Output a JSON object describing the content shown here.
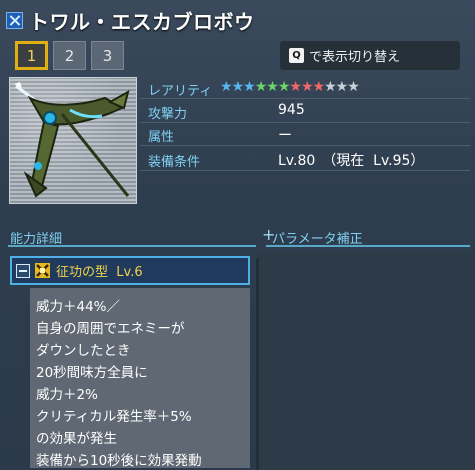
{
  "title": "トワル・エスカブロボウ",
  "tabs": [
    "1",
    "2",
    "3"
  ],
  "active_tab": 0,
  "toggle": {
    "key": "Q",
    "text": "で表示切り替え"
  },
  "stats": {
    "rarity_label": "レアリティ",
    "rarity_stars": [
      "#55b6f0",
      "#55b6f0",
      "#55b6f0",
      "#6cd46a",
      "#6cd46a",
      "#6cd46a",
      "#f06868",
      "#f06868",
      "#f06868",
      "#c8d0d8",
      "#c8d0d8",
      "#c8d0d8"
    ],
    "attack_label": "攻撃力",
    "attack_value": "945",
    "element_label": "属性",
    "element_value": "ー",
    "requirement_label": "装備条件",
    "requirement_value": "Lv.80　（現在  Lv.95）"
  },
  "sections": {
    "ability_header": "能力詳細",
    "param_header": "パラメータ補正"
  },
  "ability": {
    "name": "征功の型",
    "level": "Lv.6",
    "description": [
      "威力＋44%／",
      "自身の周囲でエネミーが",
      "ダウンしたとき",
      "20秒間味方全員に",
      "威力＋2%",
      "クリティカル発生率＋5%",
      "の効果が発生",
      "装備から10秒後に効果発動"
    ]
  },
  "colors": {
    "accent_blue": "#7fd0f0",
    "tab_active": "#e0b012",
    "ability_name": "#f0d24a"
  }
}
